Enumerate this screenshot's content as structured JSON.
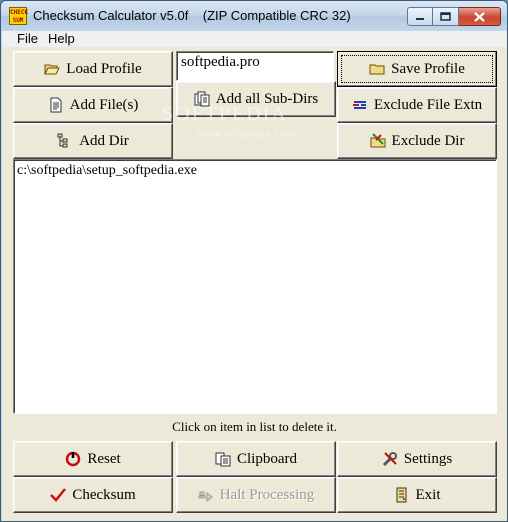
{
  "window": {
    "title": "Checksum Calculator v5.0f    (ZIP Compatible CRC 32)",
    "icon_text": "CHECK SUM",
    "controls": [
      "minimize-icon",
      "maximize-icon",
      "close-icon"
    ]
  },
  "menu": [
    "File",
    "Help"
  ],
  "profile_input": {
    "value": "softpedia.pro"
  },
  "buttons": {
    "load_profile": "Load Profile",
    "save_profile": "Save Profile",
    "add_files": "Add File(s)",
    "add_all_subdirs": "Add all Sub-Dirs",
    "exclude_file_extn": "Exclude File Extn",
    "add_dir": "Add Dir",
    "exclude_dir": "Exclude Dir",
    "reset": "Reset",
    "clipboard": "Clipboard",
    "settings": "Settings",
    "checksum": "Checksum",
    "halt_processing": "Halt Processing",
    "exit": "Exit"
  },
  "file_list": [
    "c:\\softpedia\\setup_softpedia.exe"
  ],
  "hint": "Click on item in list to delete it.",
  "watermark": "SOFTPEDIA",
  "watermark_url": "www.softpedia.com",
  "colors": {
    "face": "#ece9d8",
    "title_bg": "#c5d7ea",
    "close_red": "#c8472f",
    "checkmark_red": "#d01010"
  }
}
